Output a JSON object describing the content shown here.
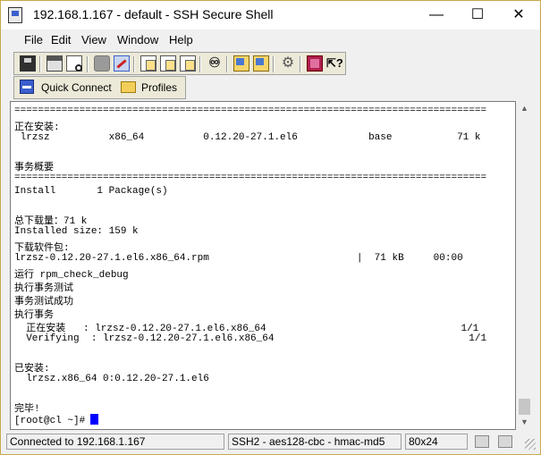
{
  "window": {
    "title": "192.168.1.167 - default - SSH Secure Shell",
    "minimize_glyph": "—",
    "maximize_glyph": "☐",
    "close_glyph": "✕"
  },
  "menu": [
    "File",
    "Edit",
    "View",
    "Window",
    "Help"
  ],
  "toolbar": {
    "icons": [
      "save-icon",
      "print-icon",
      "print-preview-icon",
      "disconnect-icon",
      "connect-icon",
      "copy-icon",
      "paste-icon",
      "paste-clipboard-icon",
      "find-icon",
      "settings-icon",
      "file-transfer-icon",
      "options-icon",
      "help-book-icon",
      "context-help-icon"
    ]
  },
  "quickbar": {
    "quick_connect": "Quick Connect",
    "profiles": "Profiles"
  },
  "terminal": {
    "lines": [
      "================================================================================",
      "正在安装:",
      " lrzsz          x86_64          0.12.20-27.1.el6            base           71 k",
      "",
      "事务概要",
      "================================================================================",
      "Install       1 Package(s)",
      "",
      "总下载量：71 k",
      "Installed size: 159 k",
      "下载软件包:",
      "lrzsz-0.12.20-27.1.el6.x86_64.rpm                         |  71 kB     00:00",
      "运行 rpm_check_debug",
      "执行事务测试",
      "事务测试成功",
      "执行事务",
      "  正在安装   : lrzsz-0.12.20-27.1.el6.x86_64                                 1/1",
      "  Verifying  : lrzsz-0.12.20-27.1.el6.x86_64                                 1/1",
      "",
      "已安装:",
      "  lrzsz.x86_64 0:0.12.20-27.1.el6",
      "",
      "完毕!"
    ],
    "prompt": "[root@cl ~]#"
  },
  "status": {
    "connection": "Connected to 192.168.1.167",
    "cipher": "SSH2 - aes128-cbc - hmac-md5",
    "size": "80x24"
  }
}
